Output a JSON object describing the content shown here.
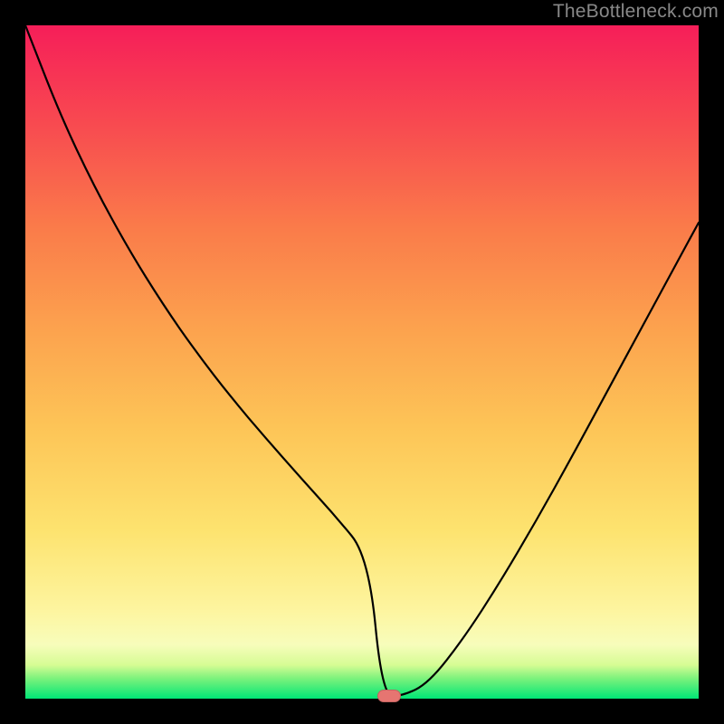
{
  "watermark": "TheBottleneck.com",
  "chart_data": {
    "type": "line",
    "title": "",
    "xlabel": "",
    "ylabel": "",
    "xlim": [
      0,
      100
    ],
    "ylim": [
      0,
      100
    ],
    "background_gradient": {
      "top": "#f61e59",
      "upper": "#fa7b4a",
      "mid": "#fde36f",
      "lower": "#f7fdbb",
      "bottom": "#00e676"
    },
    "curve_note": "V-shaped black curve; steep decreasing left segment, minimum marked by pill, shallower increasing right segment",
    "x": [
      0.0,
      5.1,
      10.2,
      15.3,
      20.4,
      25.5,
      30.6,
      35.7,
      40.8,
      45.9,
      51.0,
      53.0,
      56.0,
      59.9,
      65.2,
      70.5,
      75.8,
      81.1,
      86.4,
      91.7,
      97.0,
      100.0
    ],
    "values": [
      100.0,
      86.9,
      76.1,
      66.8,
      58.6,
      51.3,
      44.7,
      38.7,
      32.9,
      27.3,
      21.1,
      0.4,
      0.4,
      2.3,
      9.1,
      17.3,
      26.3,
      35.8,
      45.6,
      55.4,
      65.2,
      70.7
    ],
    "minimum_marker": {
      "x": 54.0,
      "y": 0.4
    },
    "marker_color": "#e67571"
  }
}
